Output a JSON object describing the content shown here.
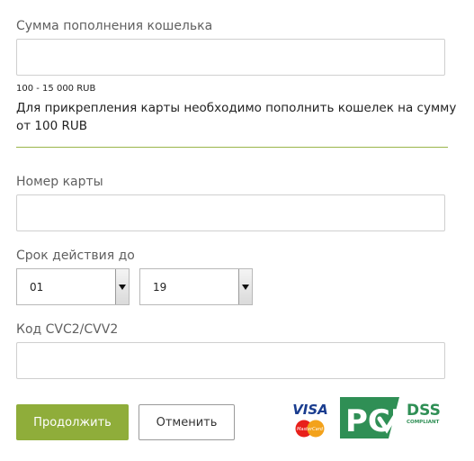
{
  "amount": {
    "label": "Сумма пополнения кошелька",
    "value": "",
    "range_hint": "100 - 15 000 RUB",
    "attach_hint": "Для прикрепления карты необходимо пополнить кошелек на сумму от 100 RUB"
  },
  "card": {
    "number_label": "Номер карты",
    "number_value": "",
    "expiry_label": "Срок действия до",
    "expiry_month": "01",
    "expiry_year": "19",
    "cvc_label": "Код CVC2/CVV2",
    "cvc_value": ""
  },
  "actions": {
    "continue_label": "Продолжить",
    "cancel_label": "Отменить"
  },
  "logos": {
    "visa": "VISA",
    "mastercard": "MasterCard",
    "pci": "PCI",
    "dss": "DSS",
    "compliant": "COMPLIANT"
  },
  "colors": {
    "accent": "#8fad3a",
    "pci_green": "#2f8f55",
    "visa_blue": "#1a3d8f",
    "mc_red": "#e8201b",
    "mc_orange": "#f3a21b"
  }
}
